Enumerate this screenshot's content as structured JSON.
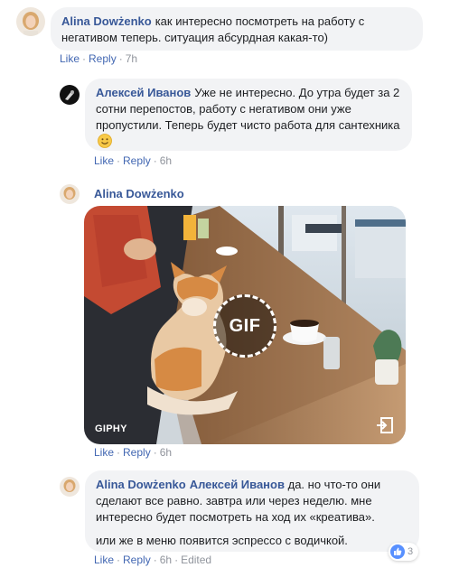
{
  "comments": [
    {
      "author": "Alina Dowżenko",
      "text": "как интересно посмотреть на работу с негативом теперь. ситуация абсурдная какая-то)",
      "actions": {
        "like": "Like",
        "reply": "Reply",
        "time": "7h"
      }
    },
    {
      "author": "Алексей Иванов",
      "text": "Уже не интересно. До утра будет за 2 сотни перепостов, работу с негативом они уже пропустили. Теперь будет чисто работа для сантехника",
      "emoji": "smiley-icon",
      "actions": {
        "like": "Like",
        "reply": "Reply",
        "time": "6h"
      }
    },
    {
      "author": "Alina Dowżenko",
      "gif": {
        "badge": "GIF",
        "provider": "GIPHY"
      },
      "actions": {
        "like": "Like",
        "reply": "Reply",
        "time": "6h"
      }
    },
    {
      "author": "Alina Dowżenko",
      "mention": "Алексей Иванов",
      "text": "да. но что-то они сделают все равно. завтра или через неделю. мне интересно будет посмотреть на ход их «креатива».",
      "text2": "или же в меню появится эспрессо с водичкой.",
      "reactions": {
        "icon": "like-icon",
        "count": "3"
      },
      "actions": {
        "like": "Like",
        "reply": "Reply",
        "time": "6h",
        "edited": "Edited"
      }
    }
  ],
  "colors": {
    "link": "#385898",
    "action": "#4267b2",
    "bubble": "#f2f3f5",
    "meta": "#90949c"
  }
}
